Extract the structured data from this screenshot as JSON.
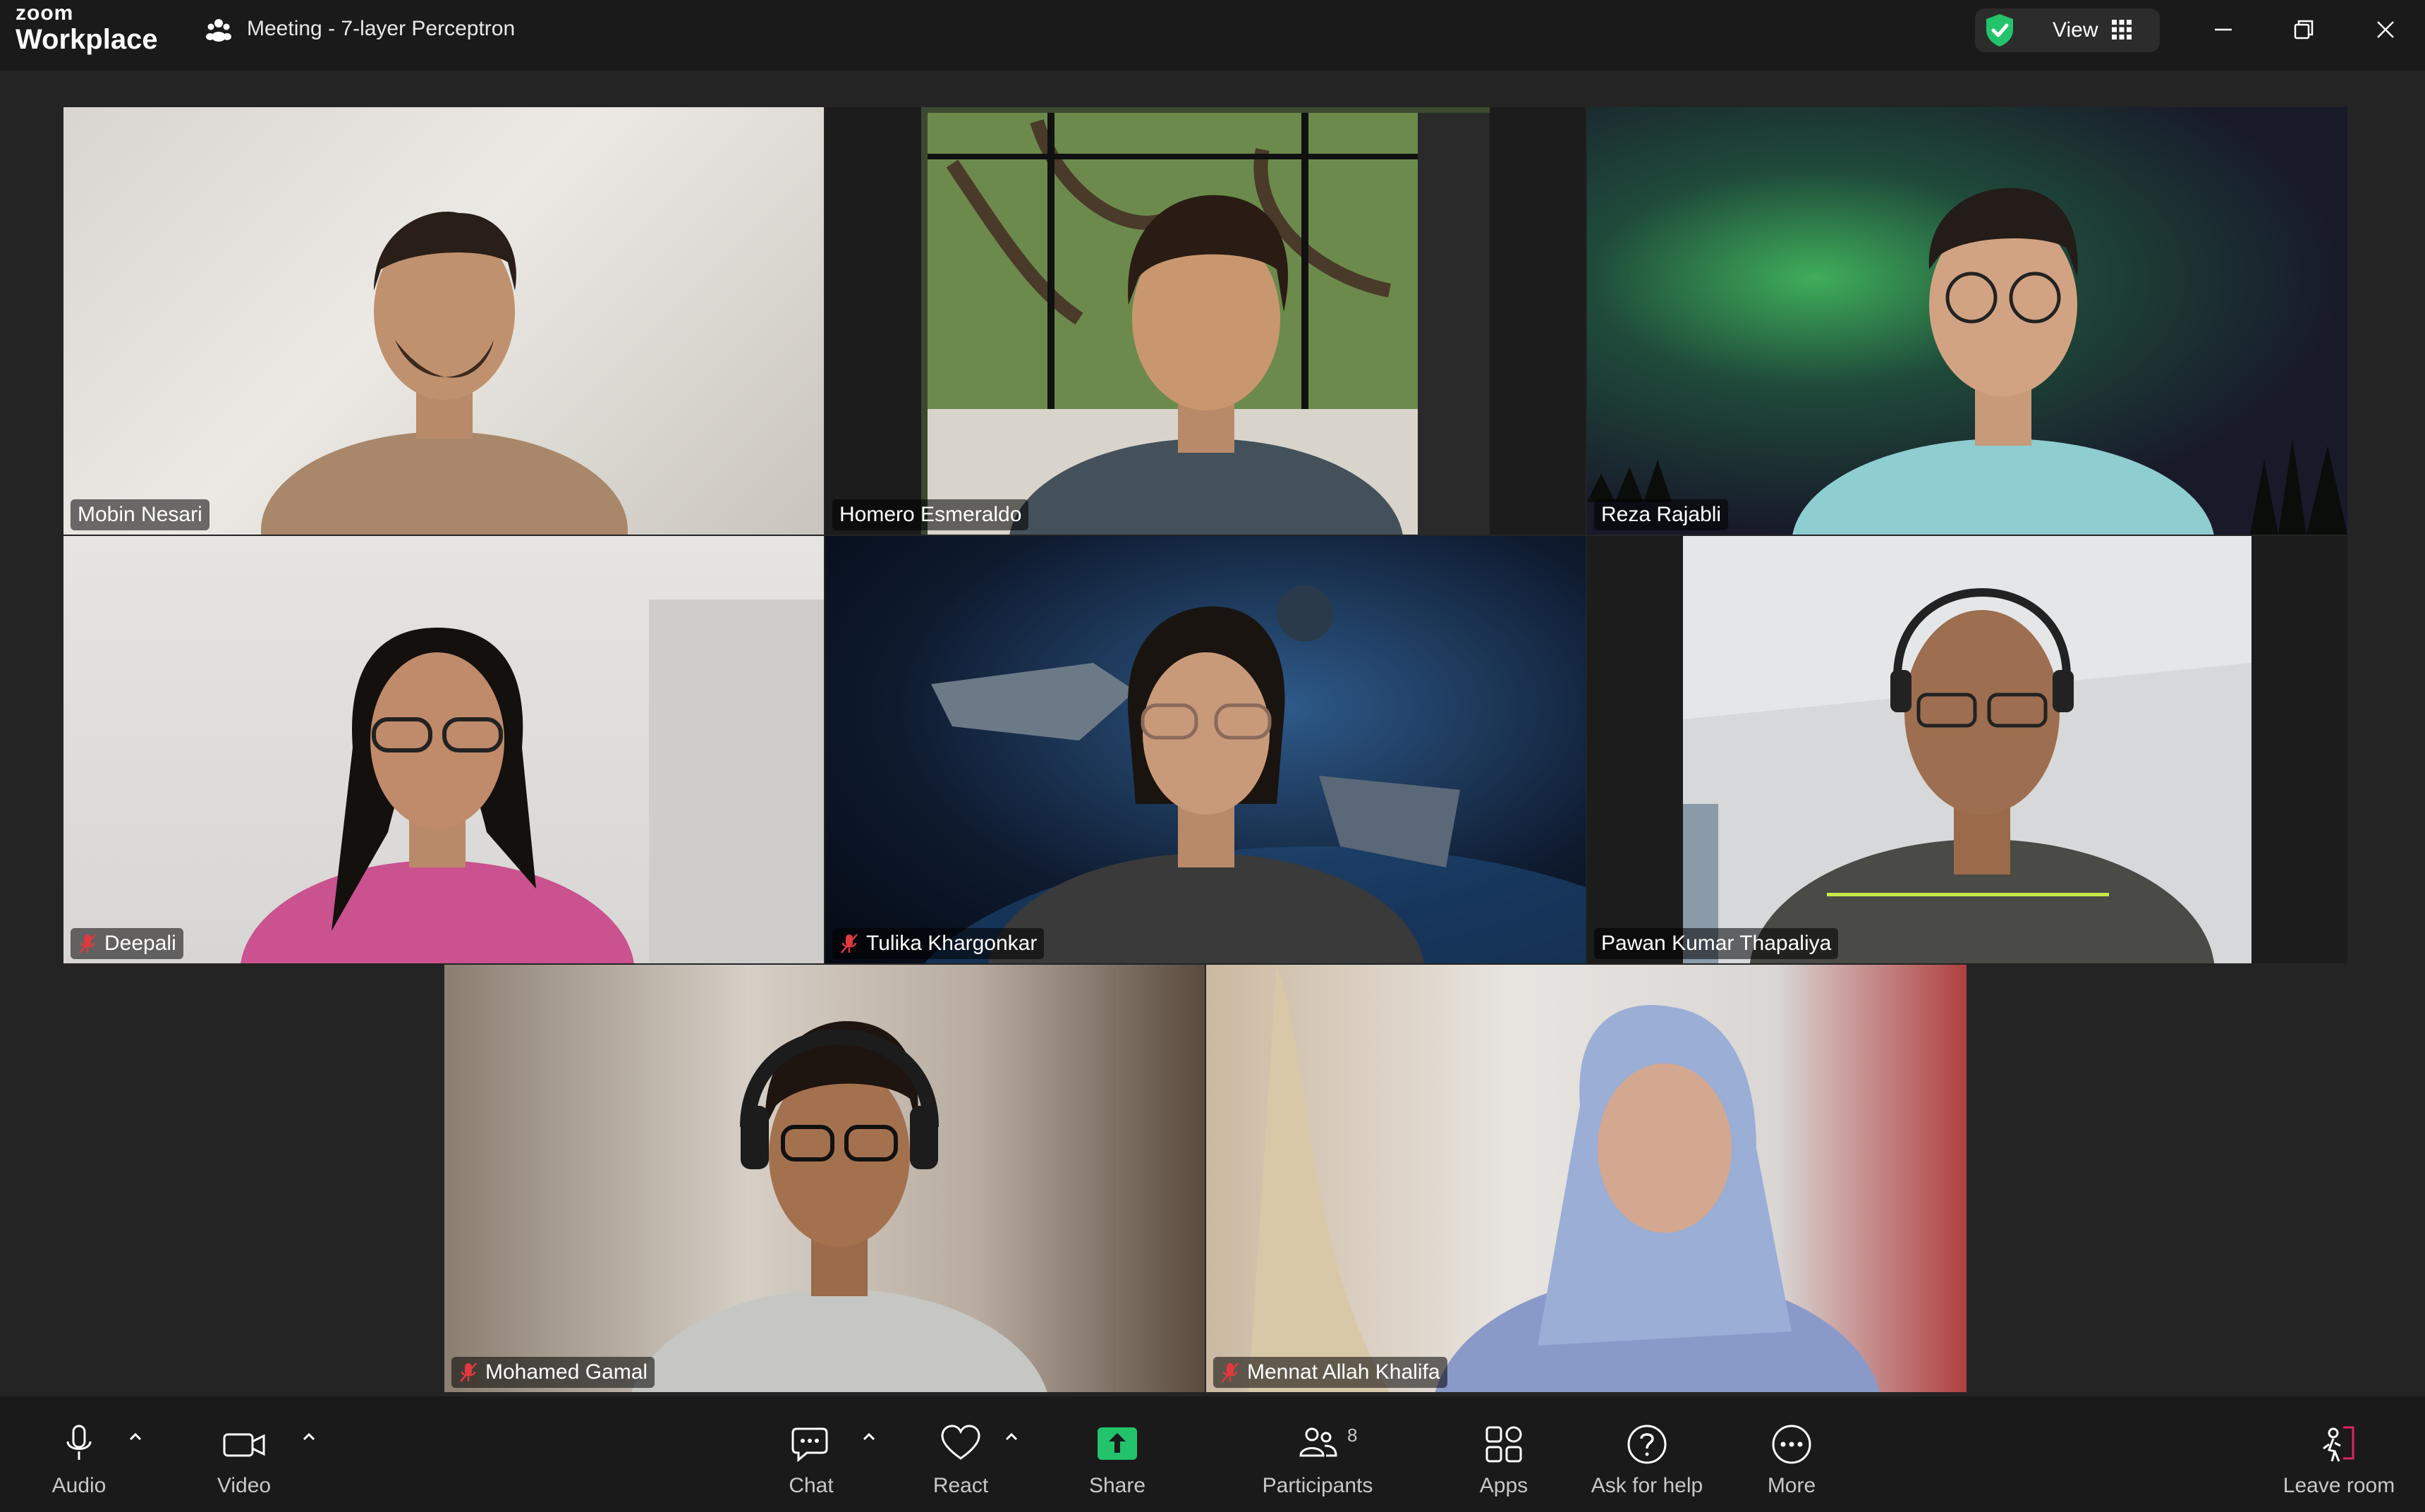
{
  "app": {
    "logo_line1": "zoom",
    "logo_line2": "Workplace",
    "meeting_title": "Meeting - 7-layer Perceptron"
  },
  "header": {
    "view_label": "View"
  },
  "colors": {
    "active_speaker": "#2bd57c",
    "muted_icon": "#e0393e",
    "share_green": "#23c36b",
    "leave_accent": "#e0245e"
  },
  "participants": [
    {
      "name": "Mobin Nesari",
      "muted": false,
      "active": false
    },
    {
      "name": "Homero Esmeraldo",
      "muted": false,
      "active": true
    },
    {
      "name": "Reza Rajabli",
      "muted": false,
      "active": false
    },
    {
      "name": "Deepali",
      "muted": true,
      "active": false
    },
    {
      "name": "Tulika Khargonkar",
      "muted": true,
      "active": false
    },
    {
      "name": "Pawan Kumar Thapaliya",
      "muted": false,
      "active": false
    },
    {
      "name": "Mohamed Gamal",
      "muted": true,
      "active": false
    },
    {
      "name": "Mennat Allah Khalifa",
      "muted": true,
      "active": false
    }
  ],
  "toolbar": {
    "audio": "Audio",
    "video": "Video",
    "chat": "Chat",
    "react": "React",
    "share": "Share",
    "participants": "Participants",
    "participants_count": "8",
    "apps": "Apps",
    "help": "Ask for help",
    "more": "More",
    "leave": "Leave room"
  }
}
